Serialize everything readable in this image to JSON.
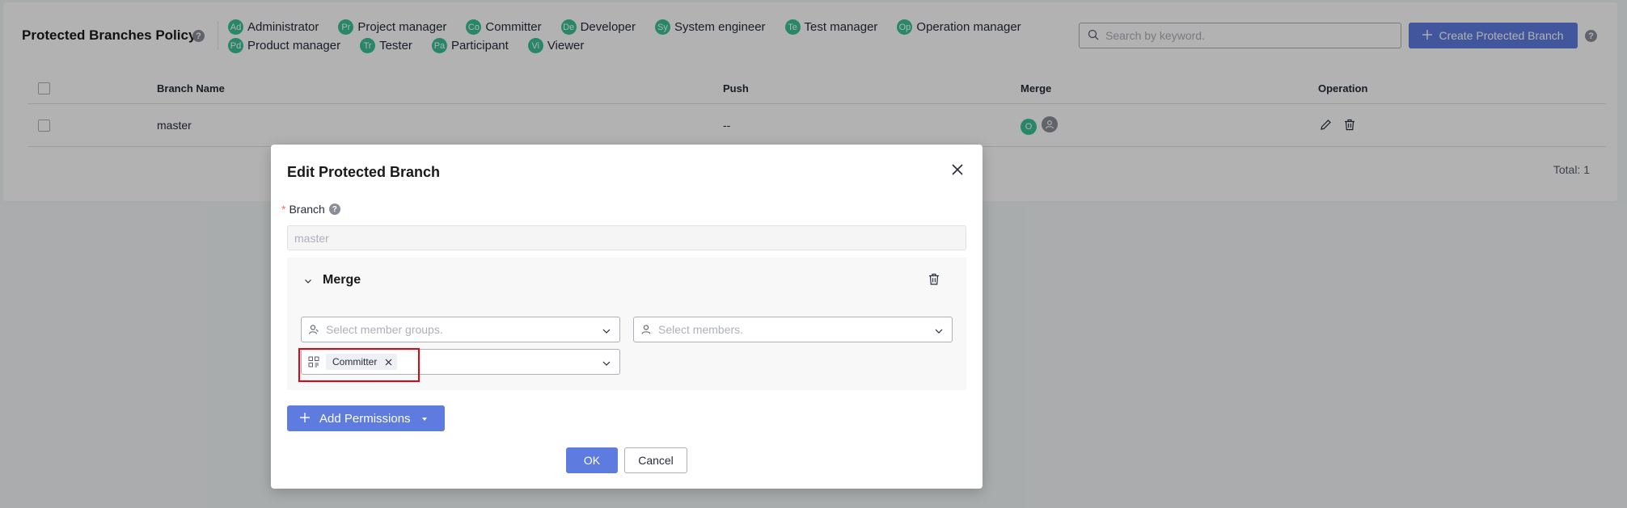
{
  "policy": {
    "title": "Protected Branches Policy",
    "roles": [
      [
        {
          "abbr": "Ad",
          "name": "Administrator"
        },
        {
          "abbr": "Pr",
          "name": "Project manager"
        },
        {
          "abbr": "Co",
          "name": "Committer"
        },
        {
          "abbr": "De",
          "name": "Developer"
        },
        {
          "abbr": "Sy",
          "name": "System engineer"
        },
        {
          "abbr": "Te",
          "name": "Test manager"
        },
        {
          "abbr": "Op",
          "name": "Operation manager"
        }
      ],
      [
        {
          "abbr": "Pd",
          "name": "Product manager"
        },
        {
          "abbr": "Tr",
          "name": "Tester"
        },
        {
          "abbr": "Pa",
          "name": "Participant"
        },
        {
          "abbr": "Vi",
          "name": "Viewer"
        }
      ]
    ],
    "search_placeholder": "Search by keyword.",
    "create_label": "Create Protected Branch"
  },
  "table": {
    "headers": {
      "name": "Branch Name",
      "push": "Push",
      "merge": "Merge",
      "operation": "Operation"
    },
    "rows": [
      {
        "name": "master",
        "push": "--",
        "merge_avatars": [
          "O",
          ""
        ]
      }
    ],
    "total": "Total: 1"
  },
  "modal": {
    "title": "Edit Protected Branch",
    "branch_label": "Branch",
    "branch_value": "master",
    "permission": {
      "name": "Merge",
      "groups_placeholder": "Select member groups.",
      "members_placeholder": "Select members.",
      "selected_role": "Committer"
    },
    "add_permissions_label": "Add Permissions",
    "ok_label": "OK",
    "cancel_label": "Cancel"
  },
  "colors": {
    "primary": "#5e7ce0",
    "role_badge": "#3ac295",
    "highlight": "#e60012"
  }
}
